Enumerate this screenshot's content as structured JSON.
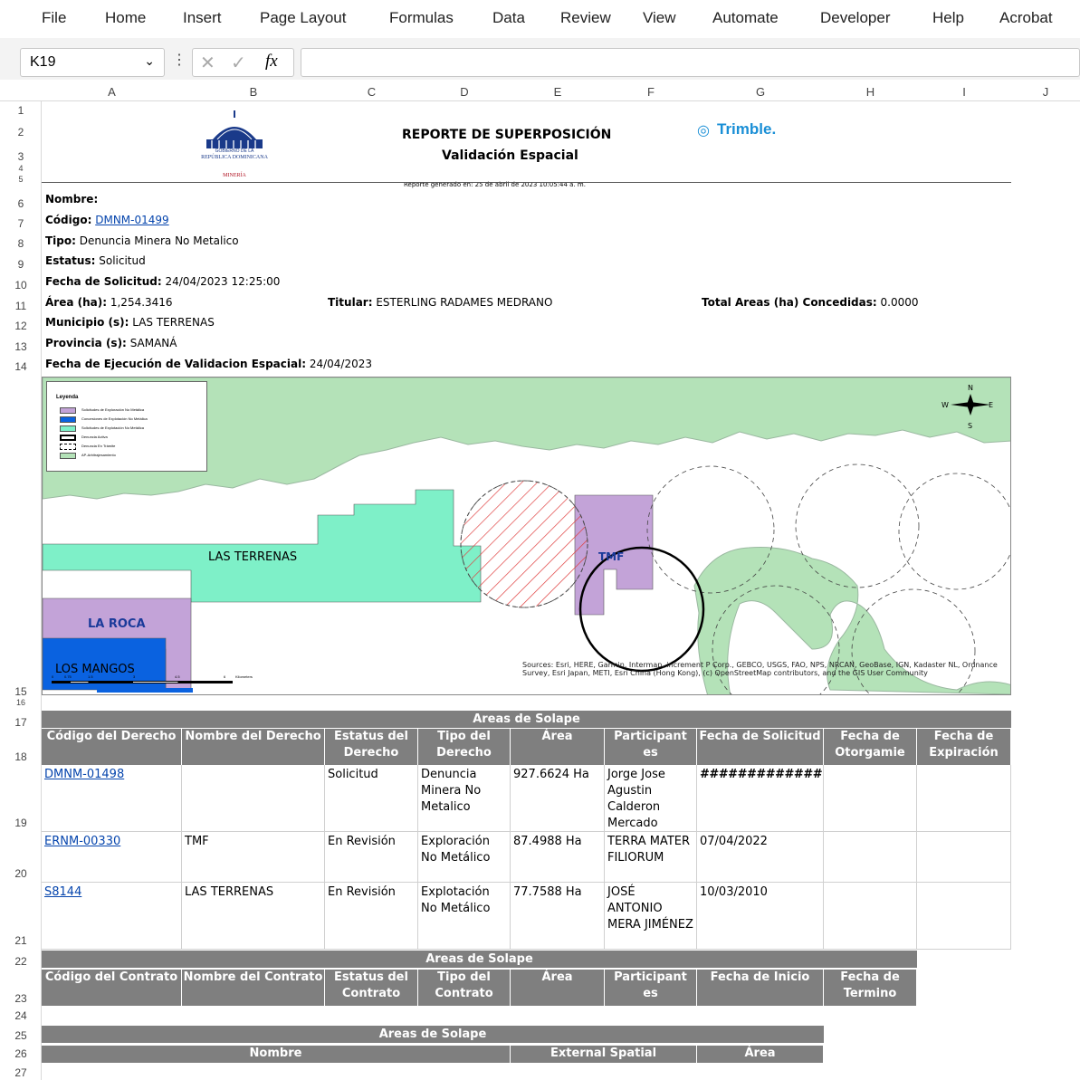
{
  "ribbon": {
    "tabs": [
      "File",
      "Home",
      "Insert",
      "Page Layout",
      "Formulas",
      "Data",
      "Review",
      "View",
      "Automate",
      "Developer",
      "Help",
      "Acrobat"
    ]
  },
  "formula_bar": {
    "cell_ref": "K19",
    "fx": "fx",
    "value": ""
  },
  "columns": [
    "A",
    "B",
    "C",
    "D",
    "E",
    "F",
    "G",
    "H",
    "I",
    "J"
  ],
  "rows": [
    "1",
    "2",
    "3",
    "4",
    "5",
    "6",
    "7",
    "8",
    "9",
    "10",
    "11",
    "12",
    "13",
    "14",
    "15",
    "16",
    "17",
    "18",
    "19",
    "20",
    "21",
    "22",
    "23",
    "24",
    "25",
    "26",
    "27"
  ],
  "report": {
    "title": "REPORTE DE SUPERPOSICIÓN",
    "subtitle": "Validación Espacial",
    "generated": "Reporte generado en: 25 de abril de 2023 10:05:44 a. m.",
    "logo_gov_line1": "GOBIERNO DE LA",
    "logo_gov_line2": "REPÚBLICA DOMINICANA",
    "logo_gov_line3": "MINERÍA",
    "logo_trimble": "Trimble."
  },
  "info": {
    "nombre_label": "Nombre:",
    "codigo_label": "Código:",
    "codigo_value": "DMNM-01499",
    "tipo_label": "Tipo:",
    "tipo_value": "Denuncia Minera No Metalico",
    "estatus_label": "Estatus:",
    "estatus_value": "Solicitud",
    "fecha_sol_label": "Fecha de Solicitud:",
    "fecha_sol_value": "24/04/2023 12:25:00",
    "area_label": "Área (ha):",
    "area_value": "1,254.3416",
    "titular_label": "Titular:",
    "titular_value": "ESTERLING RADAMES MEDRANO",
    "total_label": "Total Areas (ha) Concedidas:",
    "total_value": "0.0000",
    "municipio_label": "Municipio (s):",
    "municipio_value": "LAS TERRENAS",
    "provincia_label": "Provincia (s):",
    "provincia_value": "SAMANÁ",
    "fecha_ejec_label": "Fecha de Ejecución de Validacion Espacial:",
    "fecha_ejec_value": "24/04/2023"
  },
  "map": {
    "legend_title": "Leyenda",
    "legend_items": [
      "Solicitudes de Exploración No Metálica",
      "Concesiones de Explotación No Metálica",
      "Solicitudes de Explotación No Metálica",
      "Denuncia Activa",
      "Denuncia En Trámite",
      "AP-Arbitrajesamiento"
    ],
    "labels": [
      "LAS TERRENAS",
      "TMF",
      "LA ROCA",
      "LOS MANGOS"
    ],
    "compass": {
      "n": "N",
      "s": "S",
      "e": "E",
      "w": "W"
    },
    "scale_ticks": [
      "0",
      "0.75",
      "1.5",
      "3",
      "4.5",
      "6"
    ],
    "scale_unit": "Kilometers",
    "credits": "Sources: Esri, HERE, Garmin, Intermap, increment P Corp., GEBCO, USGS, FAO, NPS, NRCAN, GeoBase, IGN, Kadaster NL, Ordnance Survey, Esri Japan, METI, Esri China (Hong Kong), (c) OpenStreetMap contributors, and the GIS User Community",
    "colors": {
      "land": "#b4e2b8",
      "purple": "#c3a3d8",
      "teal": "#7ef0c8",
      "blue": "#0a62e0"
    }
  },
  "table1": {
    "title": "Areas de Solape",
    "headers": [
      "Código del Derecho",
      "Nombre del Derecho",
      "Estatus del Derecho",
      "Tipo del Derecho",
      "Área",
      "Participant es",
      "Fecha de Solicitud",
      "Fecha de Otorgamie",
      "Fecha de Expiración"
    ],
    "rows": [
      [
        "DMNM-01498",
        "",
        "Solicitud",
        "Denuncia Minera No Metalico",
        "927.6624 Ha",
        "Jorge Jose Agustin Calderon Mercado",
        "##############",
        "",
        ""
      ],
      [
        "ERNM-00330",
        "TMF",
        "En Revisión",
        "Exploración No Metálico",
        "87.4988 Ha",
        "TERRA MATER FILIORUM",
        "07/04/2022",
        "",
        ""
      ],
      [
        "S8144",
        "LAS TERRENAS",
        "En Revisión",
        "Explotación No Metálico",
        "77.7588 Ha",
        "JOSÉ ANTONIO MERA JIMÉNEZ",
        "10/03/2010",
        "",
        ""
      ]
    ]
  },
  "table2": {
    "title": "Areas de Solape",
    "headers": [
      "Código del Contrato",
      "Nombre del Contrato",
      "Estatus del Contrato",
      "Tipo del Contrato",
      "Área",
      "Participant es",
      "Fecha de Inicio",
      "Fecha de Termino"
    ]
  },
  "table3": {
    "title": "Areas de Solape",
    "headers": [
      "Nombre",
      "External Spatial",
      "Área"
    ]
  }
}
